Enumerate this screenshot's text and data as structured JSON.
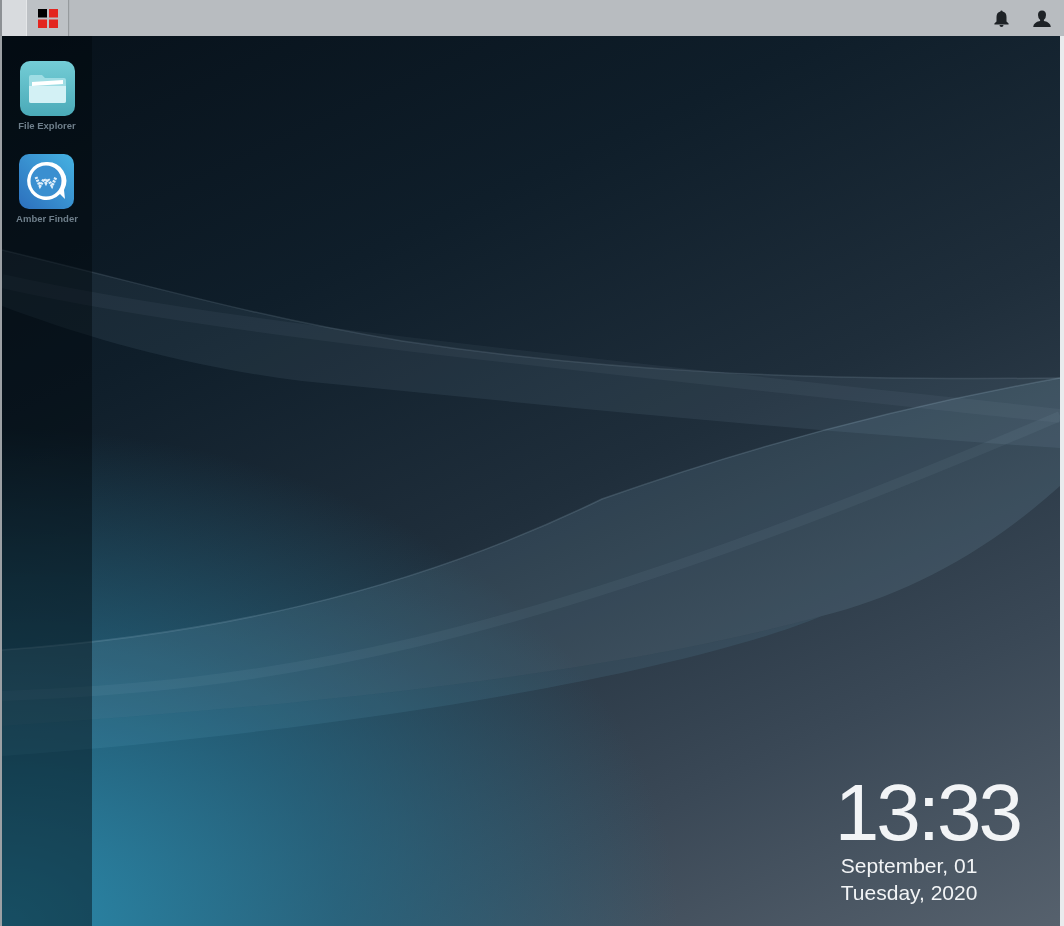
{
  "desktop_icons": [
    {
      "label": "File Explorer",
      "kind": "folder"
    },
    {
      "label": "Amber Finder",
      "kind": "chat"
    }
  ],
  "clock": {
    "time": "13:33",
    "date": "September, 01",
    "day": "Tuesday, 2020"
  }
}
